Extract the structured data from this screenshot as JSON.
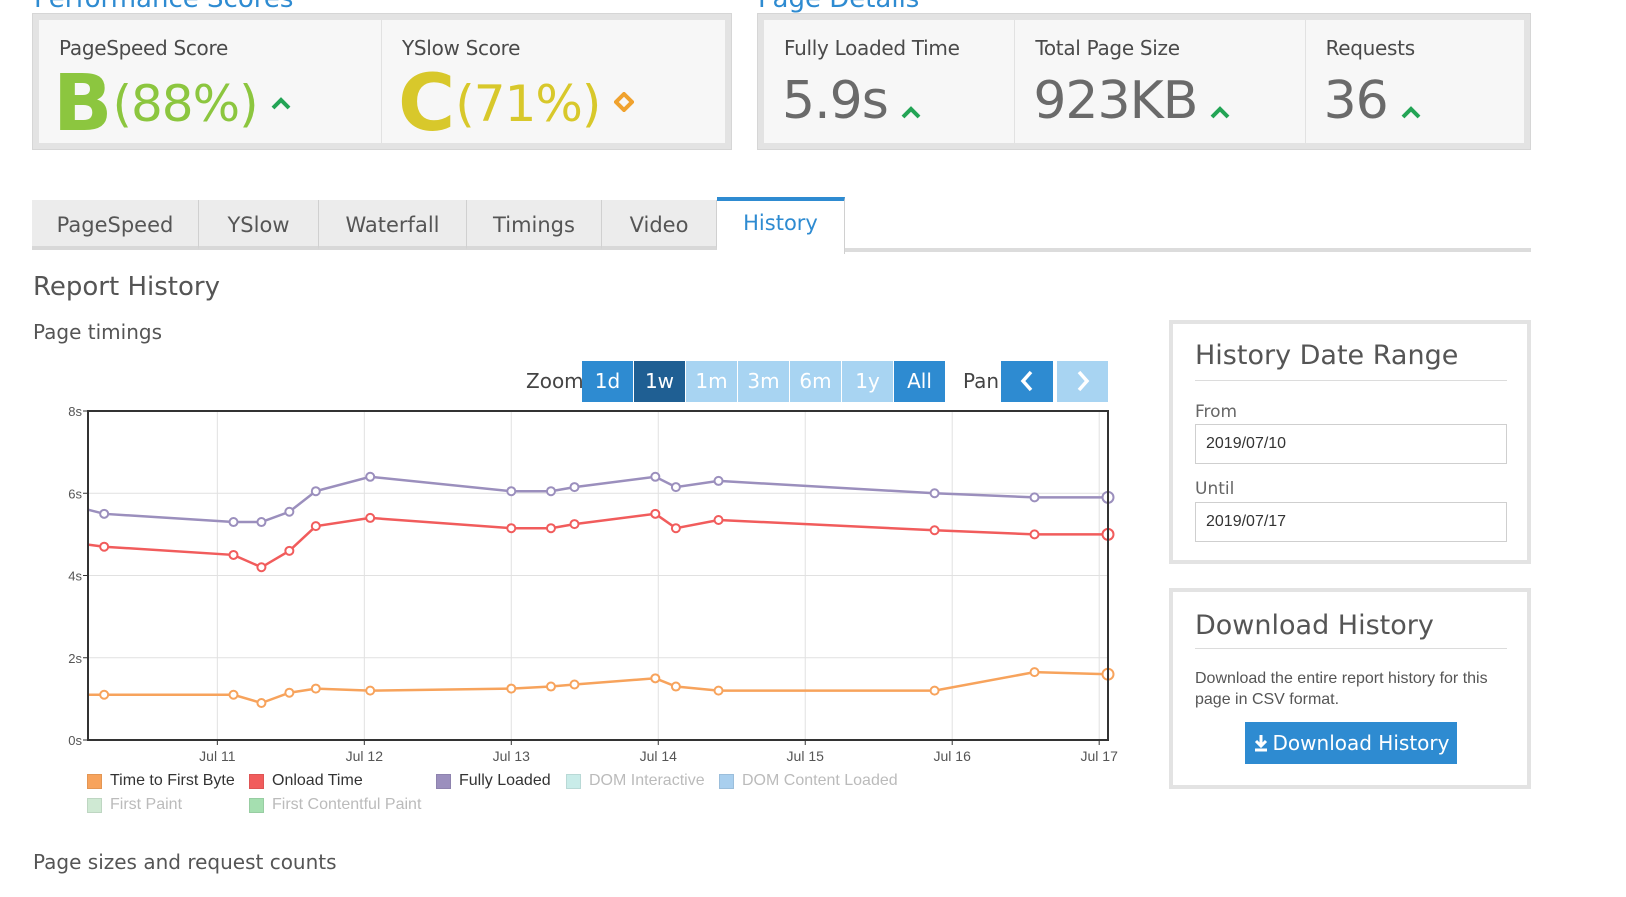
{
  "sections": {
    "performance_title": "Performance Scores",
    "page_details_title": "Page Details"
  },
  "performance": {
    "pagespeed": {
      "label": "PageSpeed Score",
      "grade": "B",
      "percent": "(88%)",
      "color": "#8cc63f",
      "trend": "up-arrow-icon"
    },
    "yslow": {
      "label": "YSlow Score",
      "grade": "C",
      "percent": "(71%)",
      "color": "#d8c82b",
      "trend": "diamond-icon"
    }
  },
  "page_details": {
    "fully_loaded": {
      "label": "Fully Loaded Time",
      "value": "5.9s"
    },
    "page_size": {
      "label": "Total Page Size",
      "value": "923KB"
    },
    "requests": {
      "label": "Requests",
      "value": "36"
    }
  },
  "tabs": [
    {
      "label": "PageSpeed"
    },
    {
      "label": "YSlow"
    },
    {
      "label": "Waterfall"
    },
    {
      "label": "Timings"
    },
    {
      "label": "Video"
    },
    {
      "label": "History",
      "active": true
    }
  ],
  "report": {
    "title": "Report History",
    "subtitle": "Page timings"
  },
  "zoom": {
    "label": "Zoom",
    "buttons": [
      {
        "label": "1d",
        "state": "enabled"
      },
      {
        "label": "1w",
        "state": "selected"
      },
      {
        "label": "1m",
        "state": "disabled"
      },
      {
        "label": "3m",
        "state": "disabled"
      },
      {
        "label": "6m",
        "state": "disabled"
      },
      {
        "label": "1y",
        "state": "disabled"
      },
      {
        "label": "All",
        "state": "enabled"
      }
    ],
    "pan_label": "Pan"
  },
  "chart_data": {
    "type": "line",
    "x_unit": "day (July 2019)",
    "xlim": [
      10.12,
      17.06
    ],
    "ylim": [
      0,
      8
    ],
    "y_ticks": [
      "0s",
      "2s",
      "4s",
      "6s",
      "8s"
    ],
    "y_tick_values": [
      0,
      2,
      4,
      6,
      8
    ],
    "x_ticks": [
      "Jul 11",
      "Jul 12",
      "Jul 13",
      "Jul 14",
      "Jul 15",
      "Jul 16",
      "Jul 17"
    ],
    "x_tick_values": [
      11,
      12,
      13,
      14,
      15,
      16,
      17
    ],
    "grid": true,
    "legend_position": "bottom",
    "x": [
      10.12,
      10.23,
      11.11,
      11.3,
      11.49,
      11.67,
      12.04,
      13.0,
      13.27,
      13.43,
      13.98,
      14.12,
      14.41,
      15.88,
      16.56,
      17.06
    ],
    "series": [
      {
        "name": "Time to First Byte",
        "color": "#f7a35c",
        "values": [
          1.1,
          1.1,
          1.1,
          0.9,
          1.15,
          1.25,
          1.2,
          1.25,
          1.3,
          1.35,
          1.5,
          1.3,
          1.2,
          1.2,
          1.65,
          1.6
        ]
      },
      {
        "name": "Onload Time",
        "color": "#f15c5c",
        "values": [
          4.75,
          4.7,
          4.5,
          4.2,
          4.6,
          5.2,
          5.4,
          5.15,
          5.15,
          5.25,
          5.5,
          5.15,
          5.35,
          5.1,
          5.0,
          5.0
        ]
      },
      {
        "name": "Fully Loaded",
        "color": "#9b8fbd",
        "values": [
          5.6,
          5.5,
          5.3,
          5.3,
          5.55,
          6.05,
          6.4,
          6.05,
          6.05,
          6.15,
          6.4,
          6.15,
          6.3,
          6.0,
          5.9,
          5.9
        ]
      },
      {
        "name": "DOM Interactive",
        "color": "#c9ece9",
        "values": []
      },
      {
        "name": "DOM Content Loaded",
        "color": "#a9cfee",
        "values": []
      },
      {
        "name": "First Paint",
        "color": "#cfe9d3",
        "values": []
      },
      {
        "name": "First Contentful Paint",
        "color": "#a5dfb0",
        "values": []
      }
    ]
  },
  "date_range": {
    "title": "History Date Range",
    "from_label": "From",
    "from_value": "2019/07/10",
    "until_label": "Until",
    "until_value": "2019/07/17"
  },
  "download": {
    "title": "Download History",
    "description_line1": "Download the entire report history for this",
    "description_line2": "page in CSV format.",
    "button_label": "Download History",
    "icon": "download-icon"
  },
  "footer": {
    "next_section_title": "Page sizes and request counts"
  }
}
